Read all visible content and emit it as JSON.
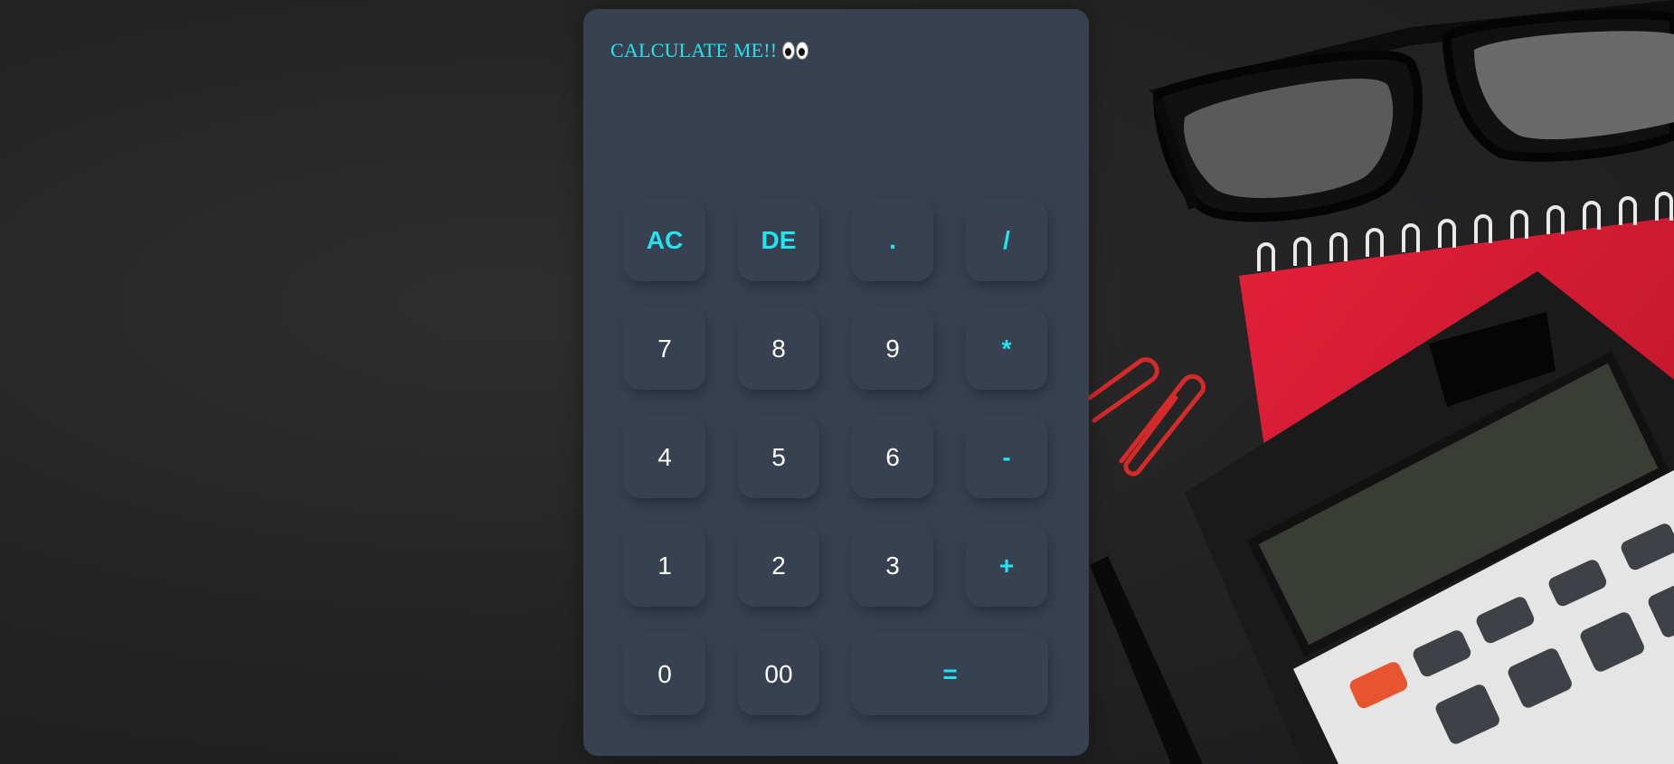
{
  "title": "CALCULATE ME!!",
  "display": "",
  "keys": {
    "ac": "AC",
    "de": "DE",
    "dot": ".",
    "div": "/",
    "k7": "7",
    "k8": "8",
    "k9": "9",
    "mul": "*",
    "k4": "4",
    "k5": "5",
    "k6": "6",
    "sub": "-",
    "k1": "1",
    "k2": "2",
    "k3": "3",
    "add": "+",
    "k0": "0",
    "k00": "00",
    "eq": "="
  },
  "colors": {
    "accent": "#22e4ee",
    "panel": "#374151",
    "digit": "#ffffff"
  },
  "icons": {
    "title_emoji": "eyes-icon"
  }
}
